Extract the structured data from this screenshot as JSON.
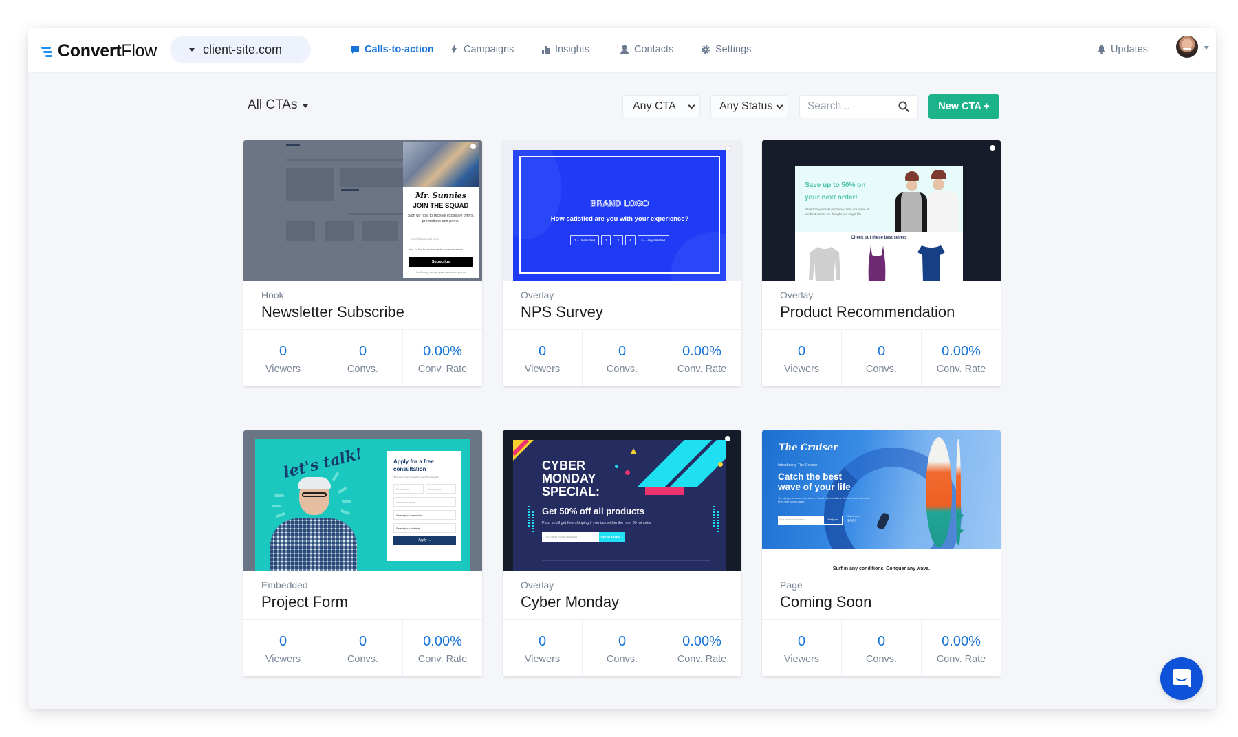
{
  "app": {
    "brand_bold": "Convert",
    "brand_light": "Flow",
    "site_selector": "client-site.com"
  },
  "nav": {
    "items": [
      {
        "label": "Calls-to-action",
        "icon": "chat-bubble-icon",
        "active": true
      },
      {
        "label": "Campaigns",
        "icon": "lightning-icon",
        "active": false
      },
      {
        "label": "Insights",
        "icon": "bar-chart-icon",
        "active": false
      },
      {
        "label": "Contacts",
        "icon": "user-icon",
        "active": false
      },
      {
        "label": "Settings",
        "icon": "gear-icon",
        "active": false
      }
    ],
    "updates_label": "Updates"
  },
  "toolbar": {
    "filter_title": "All CTAs",
    "cta_type_select": "Any CTA",
    "status_select": "Any Status",
    "search_placeholder": "Search...",
    "new_cta_label": "New CTA +"
  },
  "colors": {
    "accent": "#1673d8",
    "primary_button": "#1db38a",
    "chat_button": "#0d52d8"
  },
  "stat_labels": {
    "viewers": "Viewers",
    "convs": "Convs.",
    "rate": "Conv. Rate"
  },
  "ctas": [
    {
      "type": "Hook",
      "title": "Newsletter Subscribe",
      "viewers": "0",
      "convs": "0",
      "rate": "0.00%"
    },
    {
      "type": "Overlay",
      "title": "NPS Survey",
      "viewers": "0",
      "convs": "0",
      "rate": "0.00%"
    },
    {
      "type": "Overlay",
      "title": "Product Recommendation",
      "viewers": "0",
      "convs": "0",
      "rate": "0.00%"
    },
    {
      "type": "Embedded",
      "title": "Project Form",
      "viewers": "0",
      "convs": "0",
      "rate": "0.00%"
    },
    {
      "type": "Overlay",
      "title": "Cyber Monday",
      "viewers": "0",
      "convs": "0",
      "rate": "0.00%"
    },
    {
      "type": "Page",
      "title": "Coming Soon",
      "viewers": "0",
      "convs": "0",
      "rate": "0.00%"
    }
  ],
  "previews": {
    "newsletter": {
      "brand": "Mr. Sunnies",
      "headline": "JOIN THE SQUAD",
      "subtext": "Sign up now to receive exclusive offers, promotions and perks.",
      "email_placeholder": "email@website.com",
      "consent": "Yes, I'd like to receive email communications",
      "button": "Subscribe",
      "footer": "Don't worry, we hate spam as much as you do"
    },
    "nps": {
      "logo": "BRAND LOGO",
      "question": "How satisfied are you with your experience?",
      "options": [
        "1 = Unsatisfied",
        "2",
        "3",
        "4",
        "5 = Very satisfied"
      ]
    },
    "product": {
      "headline": "Save up to 50% on your next order!",
      "body": "Based on your last purchase, here are some of our best sellers we thought you might like.",
      "section_title": "Check out these best sellers"
    },
    "project": {
      "script": "let's talk!",
      "title": "Apply for a free consultation",
      "subtitle": "Tell us more about your business",
      "first_name": "First name",
      "last_name": "Last name",
      "email": "Your work email",
      "team_size": "Select your team size",
      "industry": "Select your industry",
      "button": "Apply →"
    },
    "cyber": {
      "headline": "CYBER MONDAY SPECIAL:",
      "offer": "Get 50% off all products",
      "body": "Plus, you'll get free shipping if you buy within the next 30 minutes",
      "email_placeholder": "Your best email address",
      "button": "GET STARTED →"
    },
    "coming": {
      "brand": "The Cruiser",
      "intro": "Introducing The Cruiser",
      "headline": "Catch the best wave of your life",
      "body": "The high-performance short board – Tested in all conditions. The only board with a tail lift for tight turning power.",
      "email_placeholder": "Your best email address",
      "button": "Notify me",
      "price_label": "Starting at",
      "price": "$599",
      "tagline": "Surf in any conditions. Conquer any wave."
    }
  }
}
